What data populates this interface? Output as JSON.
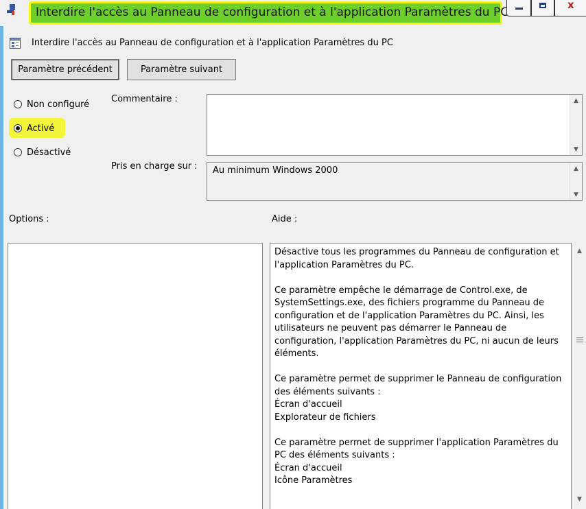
{
  "window": {
    "title": "Interdire l'accès au Panneau de configuration et à l'application Paramètres du PC",
    "controls": {
      "minimize": "minimize-icon",
      "maximize": "maximize-icon",
      "close": "close-icon"
    }
  },
  "setting": {
    "name": "Interdire l'accès au Panneau de configuration et à l'application Paramètres du PC",
    "icon": "policy-setting-icon"
  },
  "buttons": {
    "previous": "Paramètre précédent",
    "next": "Paramètre suivant"
  },
  "state": {
    "options": [
      {
        "label": "Non configuré",
        "selected": false
      },
      {
        "label": "Activé",
        "selected": true
      },
      {
        "label": "Désactivé",
        "selected": false
      }
    ]
  },
  "comment": {
    "label": "Commentaire :",
    "value": ""
  },
  "supported": {
    "label": "Pris en charge sur :",
    "value": "Au minimum Windows 2000"
  },
  "options_label": "Options :",
  "help": {
    "label": "Aide :",
    "paragraphs": [
      "Désactive tous les programmes du Panneau de configuration et l'application Paramètres du PC.",
      "Ce paramètre empêche le démarrage de Control.exe, de SystemSettings.exe, des fichiers programme du Panneau de configuration et de l'application Paramètres du PC. Ainsi, les utilisateurs ne peuvent pas démarrer le Panneau de configuration, l'application Paramètres du PC, ni aucun de leurs éléments.",
      "Ce paramètre permet de supprimer le Panneau de configuration des éléments suivants :\nÉcran d'accueil\nExplorateur de fichiers",
      "Ce paramètre permet de supprimer l'application Paramètres du PC des éléments suivants :\nÉcran d'accueil\nIcône Paramètres"
    ]
  },
  "colors": {
    "title_highlight": "#6dd02a",
    "marker_yellow": "#f2f53a",
    "window_edge": "#6ab5e4"
  }
}
